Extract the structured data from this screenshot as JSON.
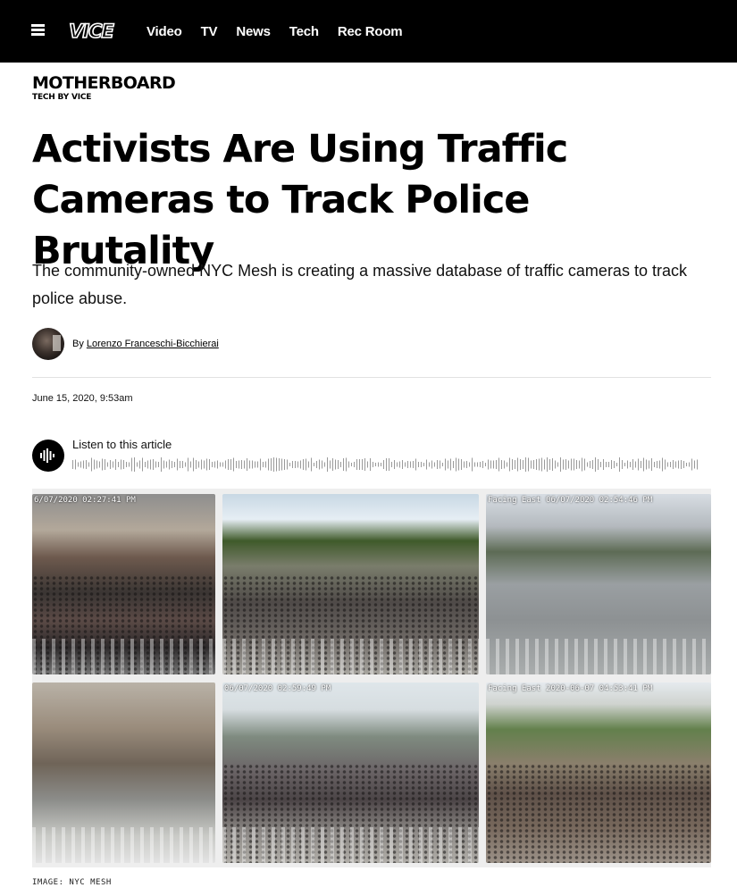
{
  "nav": {
    "logo": "VICE",
    "items": [
      "Video",
      "TV",
      "News",
      "Tech",
      "Rec Room"
    ]
  },
  "brand": {
    "name": "MOTHERBOARD",
    "tagline": "TECH BY VICE"
  },
  "article": {
    "headline": "Activists Are Using Traffic Cameras to Track Police Brutality",
    "dek": "The community-owned NYC Mesh is creating a massive database of traffic cameras to track police abuse.",
    "byline_prefix": "By",
    "author": "Lorenzo Franceschi-Bicchierai",
    "date": "June 15, 2020, 9:53am"
  },
  "audio": {
    "label": "Listen to this article"
  },
  "image": {
    "timestamps": [
      "6/07/2020 02:27:41 PM",
      "",
      "Facing East    06/07/2020 02:54:46 PM",
      "",
      "06/07/2020 02:59:49 PM",
      "Facing East 2020-06-07 04:53:41 PM"
    ],
    "caption": "IMAGE: NYC MESH"
  },
  "colors": {
    "nav_background": "#000000",
    "text": "#000000",
    "divider": "#e2e2e2"
  }
}
